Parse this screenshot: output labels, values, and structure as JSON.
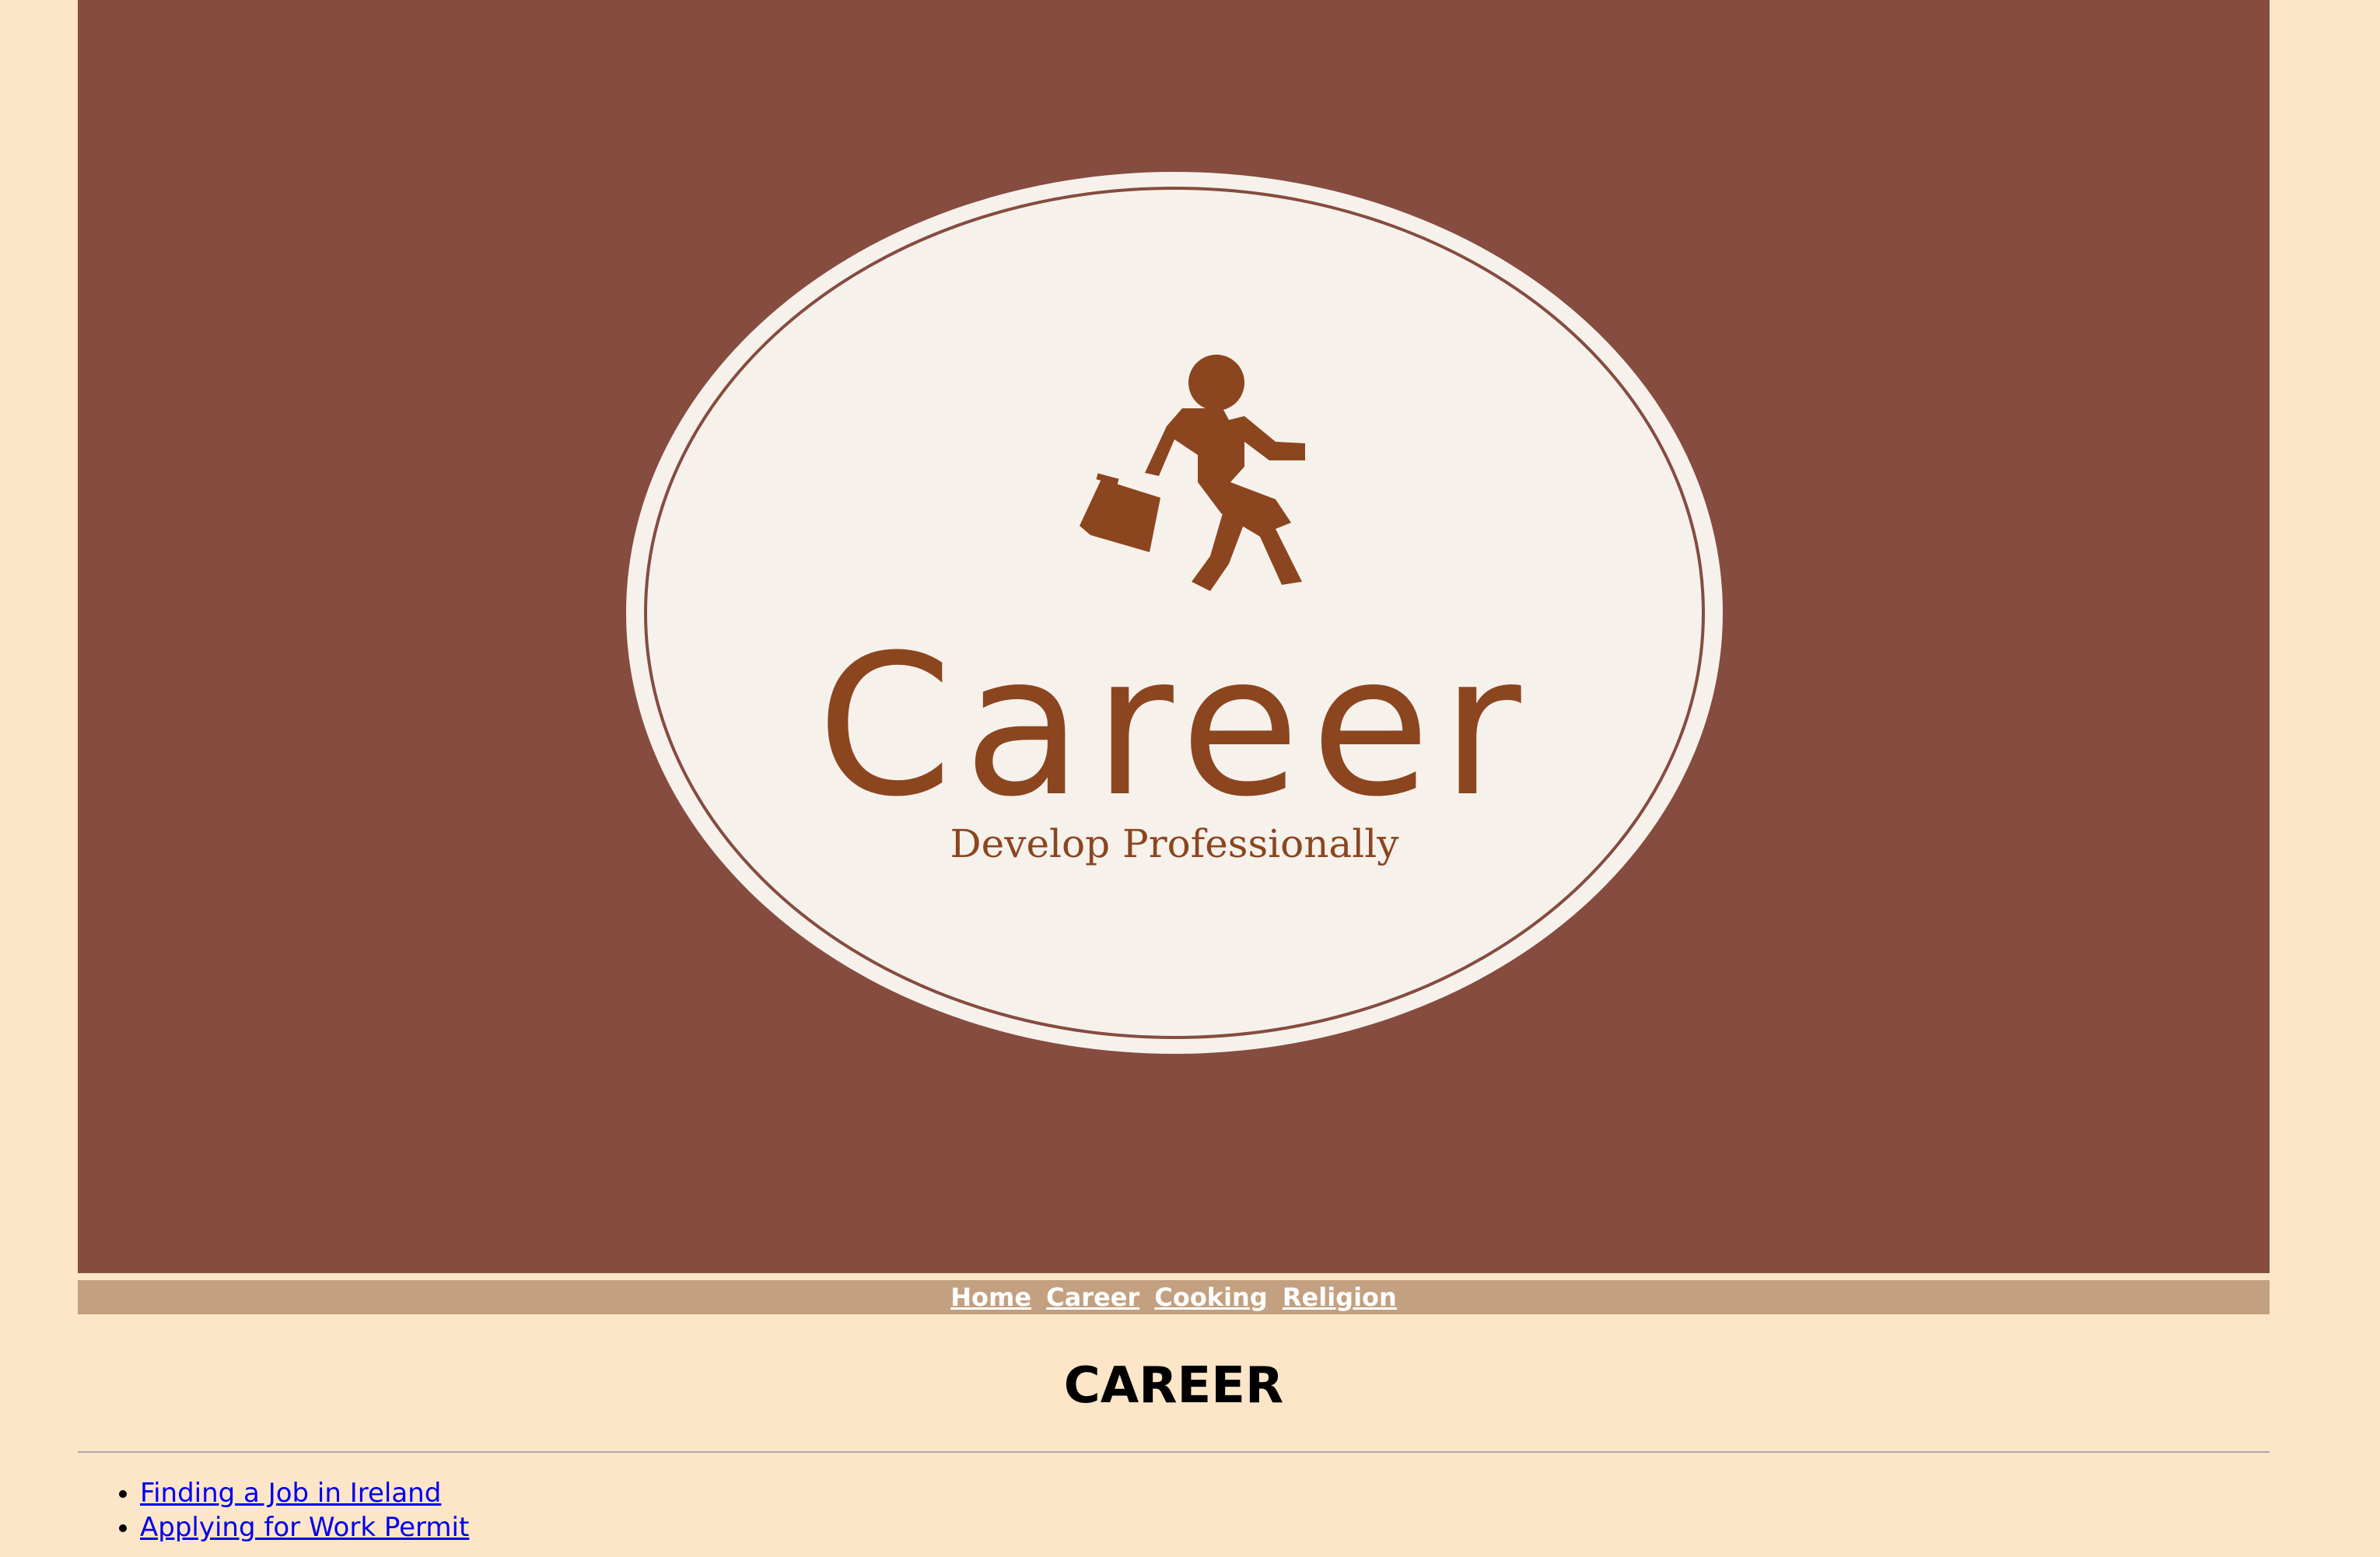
{
  "banner": {
    "logo_title": "Career",
    "logo_tagline": "Develop Professionally",
    "logo_icon": "businessman-running-icon",
    "background_color": "#854c3f",
    "oval_color": "#f7f1ec",
    "logo_color": "#8b461f"
  },
  "nav": {
    "items": [
      {
        "label": "Home"
      },
      {
        "label": "Career"
      },
      {
        "label": "Cooking"
      },
      {
        "label": "Religion"
      }
    ],
    "background_color": "#c3a07f"
  },
  "main": {
    "heading": "CAREER",
    "links": [
      {
        "label": "Finding a Job in Ireland"
      },
      {
        "label": "Applying for Work Permit"
      }
    ]
  }
}
